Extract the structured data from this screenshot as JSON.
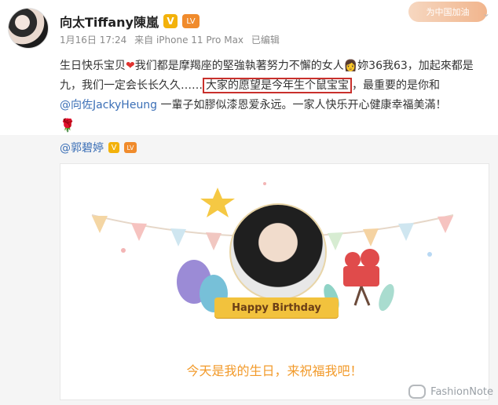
{
  "post": {
    "user_name": "向太Tiffany陳嵐",
    "badge_v": "V",
    "level_badge": "LV",
    "meta": {
      "date": "1月16日 17:24",
      "source": "来自 iPhone 11 Pro Max",
      "edited": "已编辑"
    },
    "top_badge": "为中国加油",
    "text_segments": {
      "part1": "生日快乐宝贝",
      "heart": "❤",
      "part2": "我们都是摩羯座的堅強執著努力不懈的女人",
      "emoji": "👩",
      "part3": "妳36我63，加起來都是九，我们一定会长长久久……",
      "highlight": "大家的愿望是今年生个鼠宝宝",
      "part4": "，最重要的是你和",
      "mention": "@向佐JackyHeung",
      "part5": " 一輩子如膠似漆恩爱永远。一家人快乐开心健康幸福美滿！",
      "rose": "🌹"
    }
  },
  "repost": {
    "author": "@郭碧婷",
    "card": {
      "ribbon_text": "Happy Birthday",
      "invite_text": "今天是我的生日，来祝福我吧！"
    }
  },
  "watermark": {
    "text": "FashionNote"
  }
}
